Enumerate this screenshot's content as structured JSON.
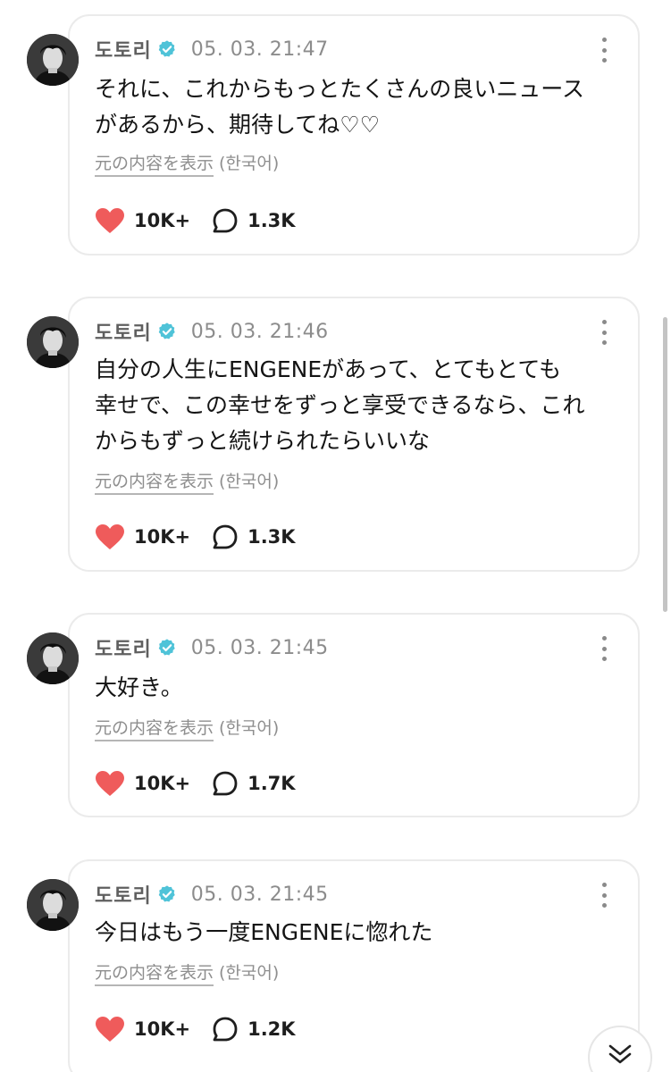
{
  "posts": [
    {
      "author": "도토리",
      "time": "05. 03. 21:47",
      "lines": [
        "それに、これからもっとたくさんの良いニュース",
        "があるから、期待してね♡♡"
      ],
      "translate_label": "元の内容を表示",
      "translate_lang": "(한국어)",
      "likes": "10K+",
      "comments": "1.3K"
    },
    {
      "author": "도토리",
      "time": "05. 03. 21:46",
      "lines": [
        "自分の人生にENGENEがあって、とてもとても",
        "幸せで、この幸せをずっと享受できるなら、これ",
        "からもずっと続けられたらいいな"
      ],
      "translate_label": "元の内容を表示",
      "translate_lang": "(한국어)",
      "likes": "10K+",
      "comments": "1.3K"
    },
    {
      "author": "도토리",
      "time": "05. 03. 21:45",
      "lines": [
        "大好き。"
      ],
      "translate_label": "元の内容を表示",
      "translate_lang": "(한국어)",
      "likes": "10K+",
      "comments": "1.7K"
    },
    {
      "author": "도토리",
      "time": "05. 03. 21:45",
      "lines": [
        "今日はもう一度ENGENEに惚れた"
      ],
      "translate_label": "元の内容を表示",
      "translate_lang": "(한국어)",
      "likes": "10K+",
      "comments": "1.2K"
    }
  ],
  "colors": {
    "like_heart": "#ef5b5b",
    "verified_badge": "#4fc3d8",
    "card_border": "#ebebeb"
  },
  "icons": {
    "verified": "verified-badge-icon",
    "like": "heart-icon",
    "comment": "comment-bubble-icon",
    "more": "more-vertical-icon",
    "scroll_down": "double-chevron-down-icon"
  }
}
